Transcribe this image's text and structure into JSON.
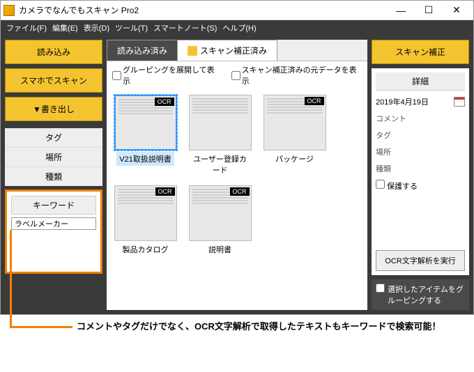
{
  "title": "カメラでなんでもスキャン Pro2",
  "menu": [
    "ファイル(F)",
    "編集(E)",
    "表示(D)",
    "ツール(T)",
    "スマートノート(S)",
    "ヘルプ(H)"
  ],
  "left": {
    "read": "読み込み",
    "smartphone": "スマホでスキャン",
    "export": "▼書き出し",
    "side": [
      "タグ",
      "場所",
      "種類"
    ],
    "keyword_label": "キーワード",
    "keyword_value": "ラベルメーカー"
  },
  "tabs": {
    "loaded": "読み込み済み",
    "corrected": "スキャン補正済み"
  },
  "checks": {
    "expand": "グルーピングを展開して表示",
    "orig": "スキャン補正済みの元データを表示"
  },
  "thumbs": [
    {
      "cap": "V21取扱説明書",
      "ocr": true,
      "sel": true
    },
    {
      "cap": "ユーザー登録カード",
      "ocr": false,
      "sel": false
    },
    {
      "cap": "パッケージ",
      "ocr": true,
      "sel": false
    },
    {
      "cap": "製品カタログ",
      "ocr": true,
      "sel": false
    },
    {
      "cap": "説明書",
      "ocr": true,
      "sel": false
    }
  ],
  "right": {
    "scan_btn": "スキャン補正",
    "detail_hdr": "詳細",
    "date": "2019年4月19日",
    "comment_lbl": "コメント",
    "tag_lbl": "タグ",
    "place_lbl": "場所",
    "type_lbl": "種類",
    "protect": "保護する",
    "ocr_run": "OCR文字解析を実行",
    "group": "選択したアイテムをグルーピングする"
  },
  "ocr_badge": "OCR",
  "annotation": "コメントやタグだけでなく、OCR文字解析で取得したテキストもキーワードで検索可能！"
}
